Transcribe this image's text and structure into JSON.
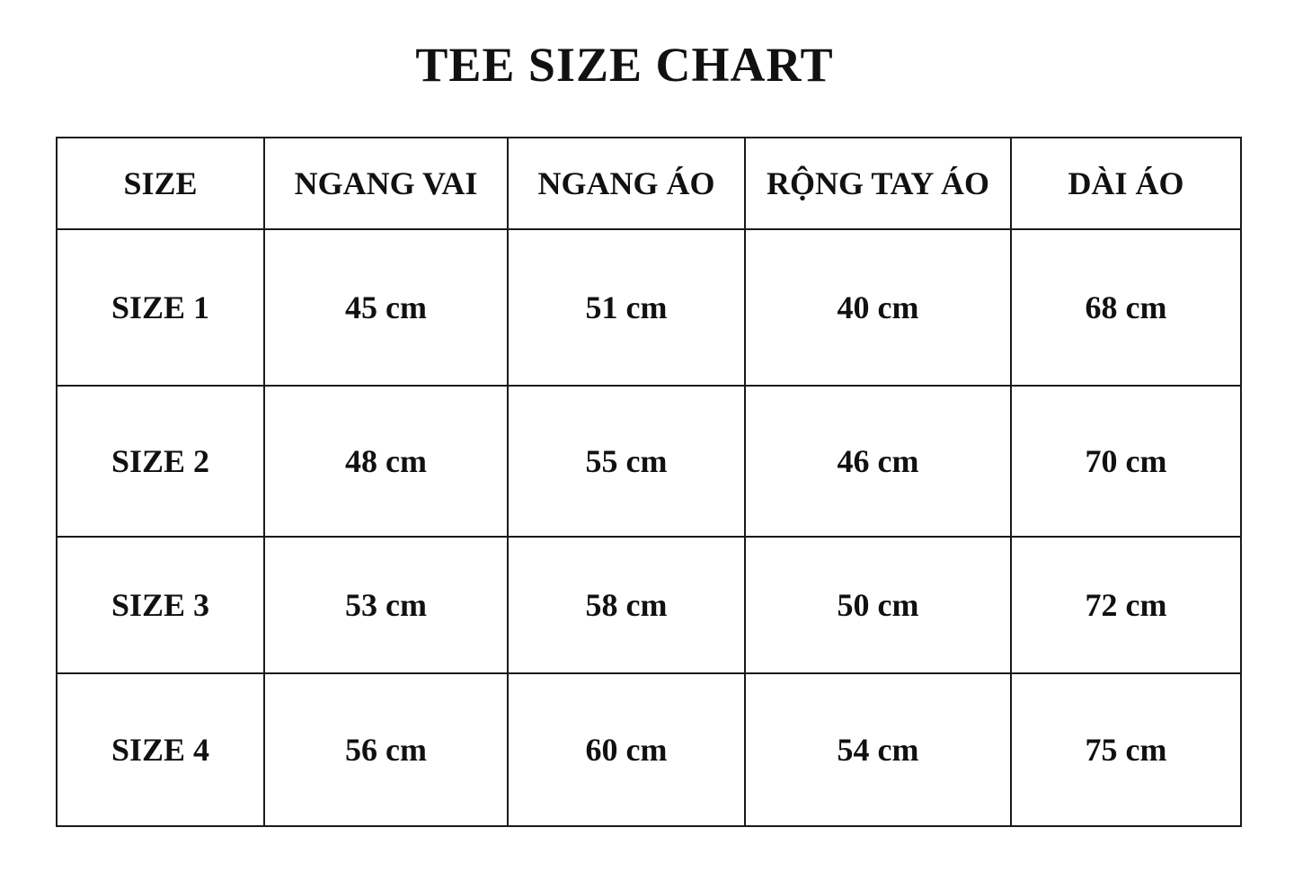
{
  "title": "TEE SIZE CHART",
  "table": {
    "headers": [
      "SIZE",
      "NGANG VAI",
      "NGANG ÁO",
      "RỘNG TAY ÁO",
      "DÀI ÁO"
    ],
    "rows": [
      [
        "SIZE 1",
        "45 cm",
        "51 cm",
        "40 cm",
        "68 cm"
      ],
      [
        "SIZE 2",
        "48 cm",
        "55 cm",
        "46 cm",
        "70 cm"
      ],
      [
        "SIZE 3",
        "53 cm",
        "58 cm",
        "50 cm",
        "72 cm"
      ],
      [
        "SIZE 4",
        "56 cm",
        "60 cm",
        "54 cm",
        "75 cm"
      ]
    ]
  }
}
